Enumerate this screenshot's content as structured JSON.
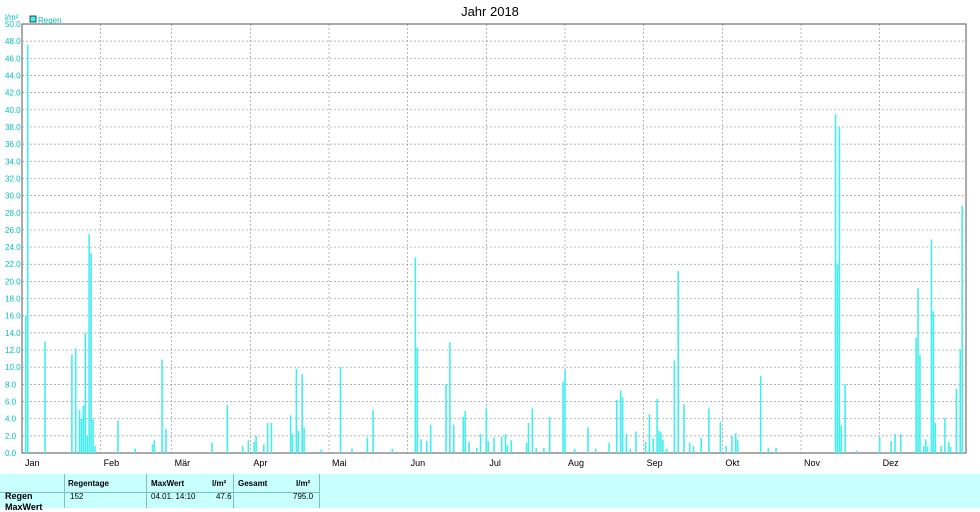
{
  "chart_data": {
    "type": "bar",
    "title": "Jahr 2018",
    "yunit": "l/m²",
    "ylim": [
      0,
      50
    ],
    "yticks": [
      "0.0",
      "2.0",
      "4.0",
      "6.0",
      "8.0",
      "10.0",
      "12.0",
      "14.0",
      "16.0",
      "18.0",
      "20.0",
      "22.0",
      "24.0",
      "26.0",
      "28.0",
      "30.0",
      "32.0",
      "34.0",
      "36.0",
      "38.0",
      "40.0",
      "42.0",
      "44.0",
      "46.0",
      "48.0",
      "50.0"
    ],
    "months": [
      "Jan",
      "Feb",
      "Mär",
      "Apr",
      "Mai",
      "Jun",
      "Jul",
      "Aug",
      "Sep",
      "Okt",
      "Nov",
      "Dez"
    ],
    "legend": "Regen",
    "color": "#44eeee",
    "grid": true,
    "series": [
      {
        "name": "Regen",
        "points": [
          [
            2,
            16
          ],
          [
            3,
            47.6
          ],
          [
            12,
            13
          ],
          [
            26,
            11.5
          ],
          [
            28,
            12.2
          ],
          [
            30,
            5
          ],
          [
            31,
            4
          ],
          [
            32,
            5.5
          ],
          [
            33,
            14
          ],
          [
            34,
            2
          ],
          [
            35,
            25.5
          ],
          [
            36,
            23.3
          ],
          [
            37,
            4
          ],
          [
            38,
            0.8
          ],
          [
            50,
            3.8
          ],
          [
            59,
            0.5
          ],
          [
            68,
            1
          ],
          [
            69,
            1.5
          ],
          [
            73,
            10.9
          ],
          [
            75,
            2.8
          ],
          [
            99,
            1.2
          ],
          [
            107,
            5.6
          ],
          [
            115,
            0.8
          ],
          [
            118,
            1.5
          ],
          [
            121,
            1.3
          ],
          [
            122,
            2
          ],
          [
            126,
            1
          ],
          [
            128,
            3.5
          ],
          [
            130,
            3.5
          ],
          [
            140,
            4.4
          ],
          [
            141,
            2.2
          ],
          [
            143,
            9.8
          ],
          [
            144,
            2.6
          ],
          [
            146,
            9.2
          ],
          [
            147,
            3
          ],
          [
            156,
            0.4
          ],
          [
            166,
            10
          ],
          [
            172,
            0.5
          ],
          [
            180,
            1.8
          ],
          [
            183,
            5
          ],
          [
            193,
            0.5
          ],
          [
            205,
            22.8
          ],
          [
            206,
            12.3
          ],
          [
            208,
            1.6
          ],
          [
            211,
            1.4
          ],
          [
            213,
            3.3
          ],
          [
            221,
            8
          ],
          [
            223,
            12.9
          ],
          [
            225,
            3.3
          ],
          [
            230,
            4.2
          ],
          [
            231,
            4.9
          ],
          [
            233,
            1.3
          ],
          [
            237,
            0.6
          ],
          [
            239,
            2.2
          ],
          [
            242,
            5.3
          ],
          [
            243,
            1.4
          ],
          [
            246,
            1.8
          ],
          [
            250,
            1.9
          ],
          [
            252,
            2.2
          ],
          [
            253,
            0.9
          ],
          [
            255,
            1.5
          ],
          [
            263,
            1.2
          ],
          [
            264,
            3.5
          ],
          [
            266,
            5.2
          ],
          [
            268,
            0.6
          ],
          [
            272,
            0.6
          ],
          [
            275,
            4.2
          ],
          [
            282,
            8.3
          ],
          [
            283,
            9.7
          ],
          [
            288,
            0.5
          ],
          [
            295,
            3
          ],
          [
            299,
            0.5
          ],
          [
            306,
            1.2
          ],
          [
            310,
            6.2
          ],
          [
            312,
            7.3
          ],
          [
            313,
            6.5
          ],
          [
            315,
            2.2
          ],
          [
            317,
            0.5
          ],
          [
            320,
            2.5
          ],
          [
            325,
            1.3
          ],
          [
            327,
            4.5
          ],
          [
            329,
            1.7
          ],
          [
            331,
            6.3
          ],
          [
            332,
            2.6
          ],
          [
            333,
            2.4
          ],
          [
            334,
            1.5
          ],
          [
            336,
            0.5
          ],
          [
            340,
            10.8
          ],
          [
            342,
            21.2
          ],
          [
            345,
            5.7
          ],
          [
            348,
            1.2
          ],
          [
            350,
            0.8
          ],
          [
            354,
            1.8
          ],
          [
            358,
            5.2
          ],
          [
            364,
            3.6
          ],
          [
            367,
            0.8
          ],
          [
            370,
            2
          ],
          [
            372,
            2.3
          ],
          [
            373,
            1.5
          ],
          [
            385,
            9
          ],
          [
            389,
            0.6
          ],
          [
            393,
            0.6
          ],
          [
            424,
            39.5
          ],
          [
            425,
            22
          ],
          [
            426,
            38
          ],
          [
            427,
            3.2
          ],
          [
            429,
            8
          ],
          [
            435,
            0.3
          ],
          [
            447,
            1.9
          ],
          [
            453,
            1.4
          ],
          [
            455,
            2.2
          ],
          [
            458,
            2.2
          ],
          [
            466,
            13.4
          ],
          [
            467,
            19.2
          ],
          [
            468,
            11.4
          ],
          [
            470,
            0.8
          ],
          [
            471,
            1.6
          ],
          [
            472,
            0.7
          ],
          [
            474,
            24.9
          ],
          [
            475,
            16.5
          ],
          [
            476,
            3.5
          ],
          [
            479,
            0.8
          ],
          [
            481,
            4.1
          ],
          [
            483,
            1.3
          ],
          [
            484,
            0.7
          ],
          [
            487,
            7.5
          ],
          [
            489,
            12.1
          ],
          [
            490,
            28.8
          ]
        ]
      }
    ]
  },
  "stats": {
    "header": [
      "Regentage",
      "MaxWert",
      "l/m²",
      "Gesamt",
      "l/m²"
    ],
    "rows": [
      {
        "label": "Regen",
        "regentage": "152",
        "maxdate": "04.01.  14:10",
        "maxval": "47.6",
        "gesamt": "795.0"
      },
      {
        "label": "MaxWert"
      }
    ]
  }
}
